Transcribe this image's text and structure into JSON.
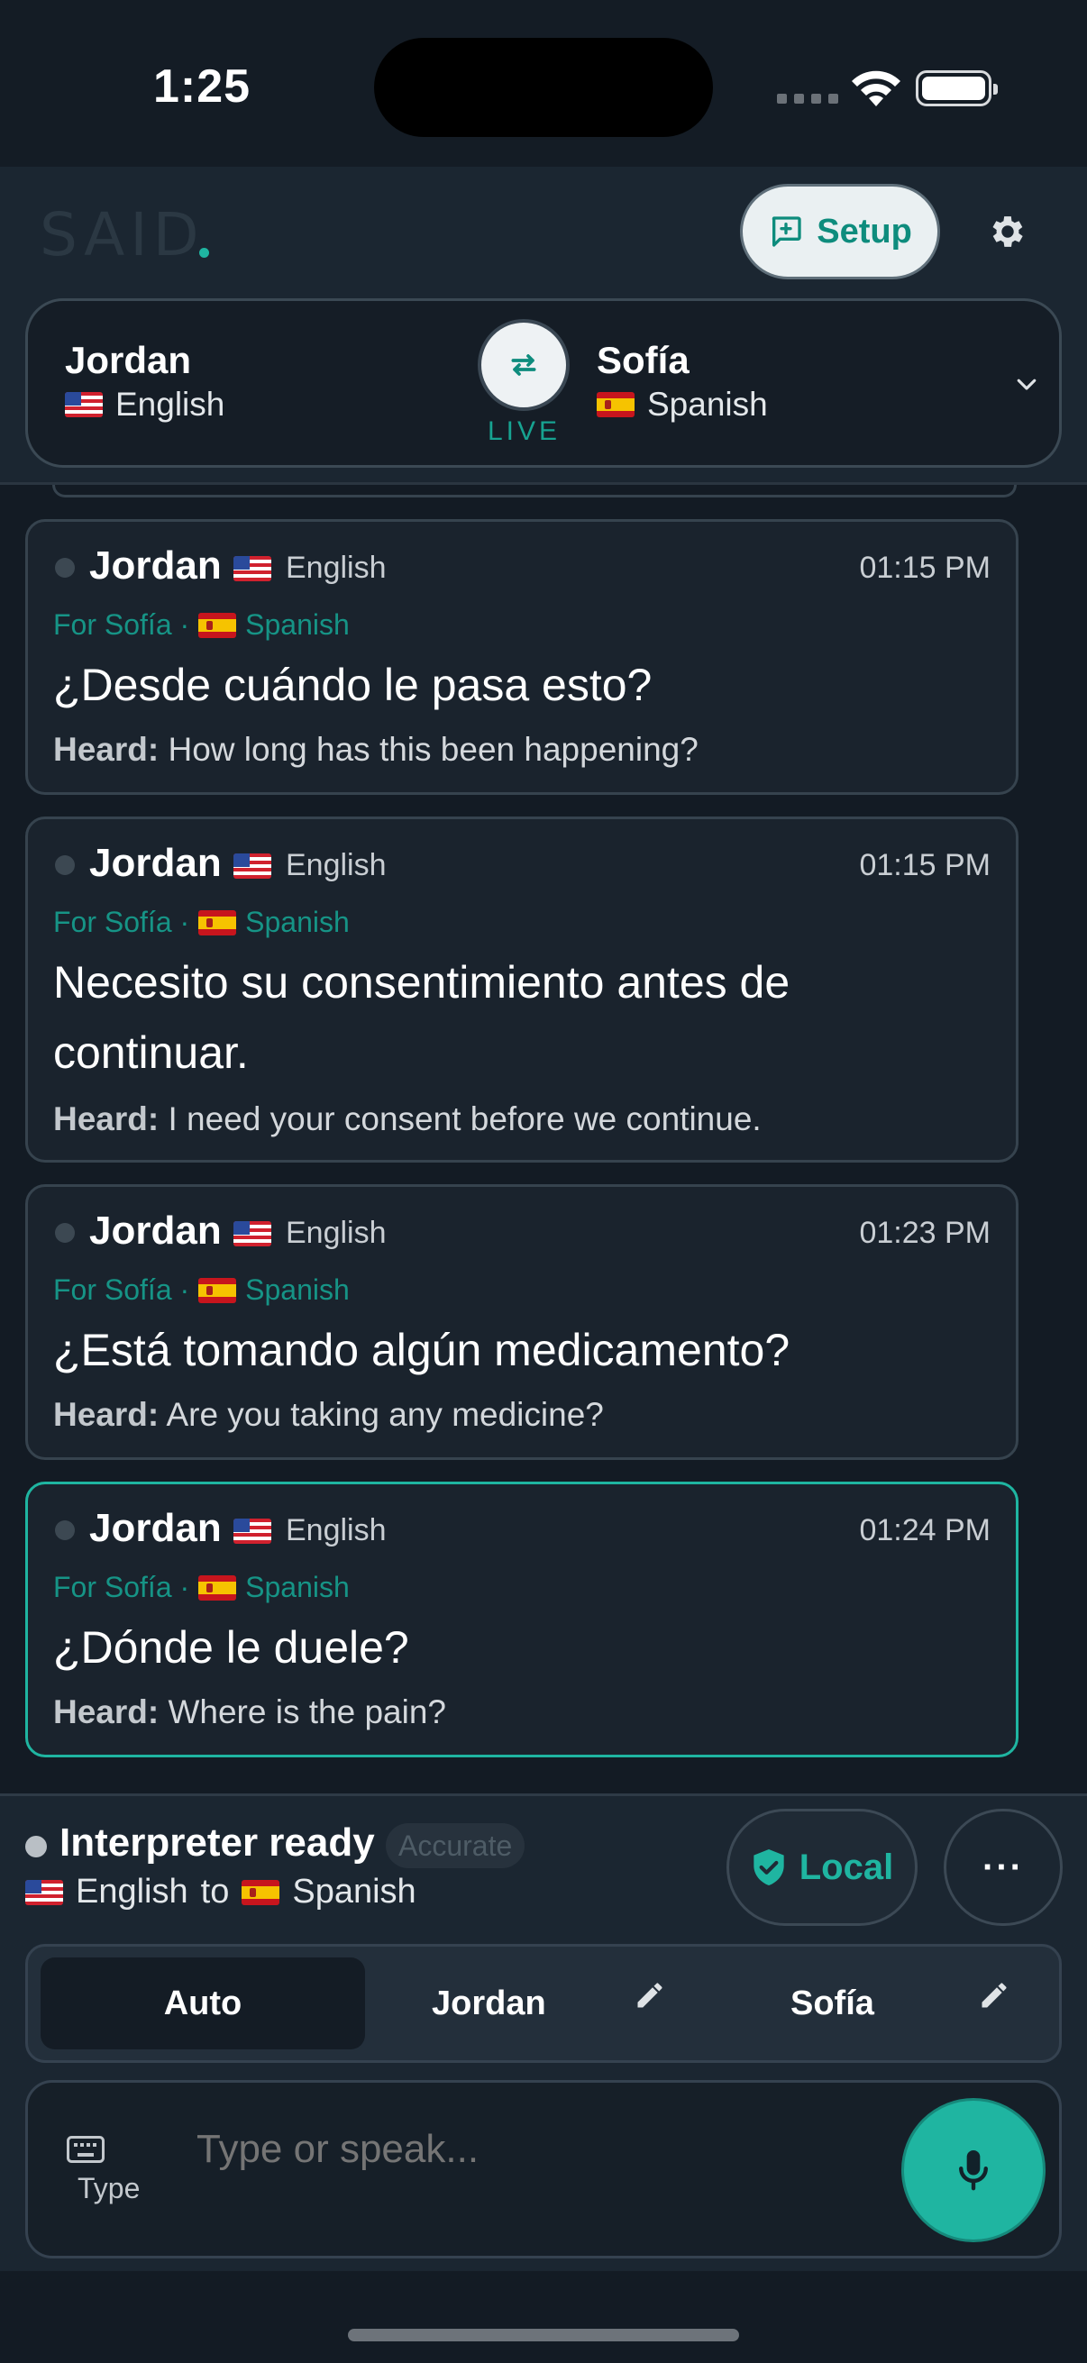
{
  "status_bar": {
    "time": "1:25"
  },
  "header": {
    "logo": "SAID",
    "setup_label": "Setup"
  },
  "conversation": {
    "left": {
      "name": "Jordan",
      "language": "English",
      "flag": "us-flag"
    },
    "right": {
      "name": "Sofía",
      "language": "Spanish",
      "flag": "es-flag"
    },
    "live_label": "LIVE"
  },
  "messages": [
    {
      "speaker": "Jordan",
      "source_language": "English",
      "time": "01:15 PM",
      "target": "For Sofía ·",
      "target_language": "Spanish",
      "translation": "¿Desde cuándo le pasa esto?",
      "heard_label": "Heard:",
      "heard": "How long has this been happening?"
    },
    {
      "speaker": "Jordan",
      "source_language": "English",
      "time": "01:15 PM",
      "target": "For Sofía ·",
      "target_language": "Spanish",
      "translation": "Necesito su consentimiento antes de continuar.",
      "heard_label": "Heard:",
      "heard": "I need your consent before we continue."
    },
    {
      "speaker": "Jordan",
      "source_language": "English",
      "time": "01:23 PM",
      "target": "For Sofía ·",
      "target_language": "Spanish",
      "translation": "¿Está tomando algún medicamento?",
      "heard_label": "Heard:",
      "heard": "Are you taking any medicine?"
    },
    {
      "speaker": "Jordan",
      "source_language": "English",
      "time": "01:24 PM",
      "target": "For Sofía ·",
      "target_language": "Spanish",
      "translation": "¿Dónde le duele?",
      "heard_label": "Heard:",
      "heard": "Where is the pain?"
    }
  ],
  "status": {
    "title": "Interpreter ready",
    "badge": "Accurate",
    "from_language": "English",
    "to_word": "to",
    "to_language": "Spanish",
    "local_label": "Local",
    "more_label": "···"
  },
  "speaker_selector": {
    "options": [
      "Auto",
      "Jordan",
      "Sofía"
    ],
    "selected": "Auto"
  },
  "composer": {
    "type_label": "Type",
    "placeholder": "Type or speak..."
  },
  "colors": {
    "accent": "#1fb5a1",
    "background": "#131b24",
    "card": "#1a232d"
  }
}
